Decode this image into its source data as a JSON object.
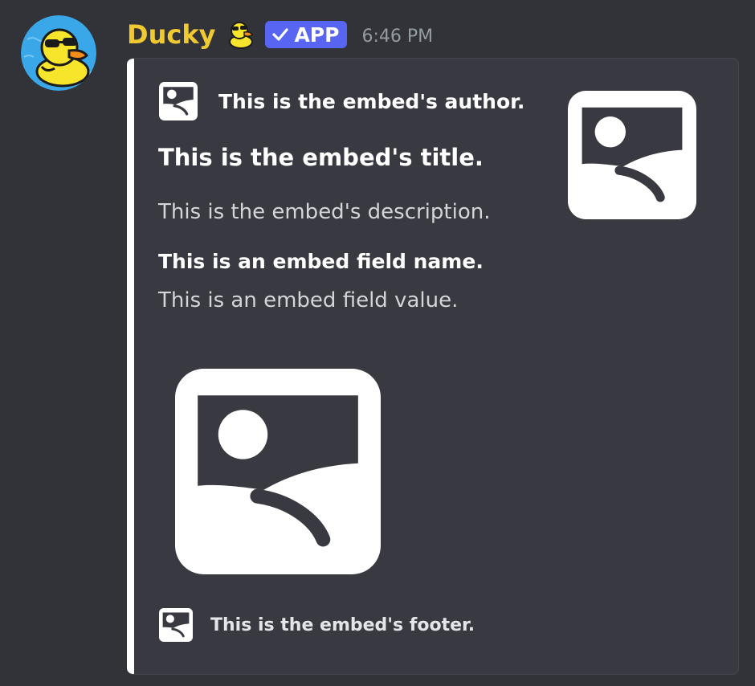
{
  "message": {
    "username": "Ducky",
    "badge": {
      "label": "APP",
      "color": "#5865f2"
    },
    "timestamp": "6:46 PM",
    "username_color": "#f0c930",
    "avatar_icon": "duck-with-sunglasses-icon",
    "name_emoji": "duck-with-sunglasses-icon"
  },
  "embed": {
    "accent_color": "#ffffff",
    "author": {
      "name": "This is the embed's author.",
      "icon": "image-placeholder-icon"
    },
    "title": "This is the embed's title.",
    "description": "This is the embed's description.",
    "fields": [
      {
        "name": "This is an embed field name.",
        "value": "This is an embed field value."
      }
    ],
    "thumbnail": "image-placeholder-icon",
    "image": "image-placeholder-icon",
    "footer": {
      "text": "This is the embed's footer.",
      "icon": "image-placeholder-icon"
    }
  }
}
